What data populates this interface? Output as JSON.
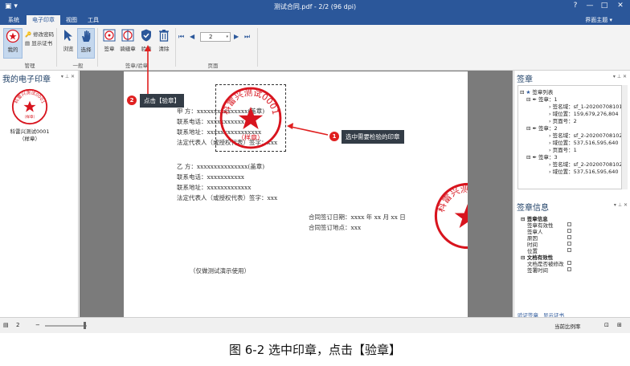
{
  "window": {
    "title": "测试合同.pdf - 2/2 (96 dpi)",
    "controls": [
      "?",
      "—",
      "□",
      "✕"
    ]
  },
  "menu": {
    "tabs": [
      "系统",
      "电子印章",
      "视图",
      "工具"
    ],
    "active": 1,
    "right": "界面主题"
  },
  "ribbon": {
    "buttons": [
      {
        "name": "my-seal-button",
        "label": "我的",
        "icon": "seal-icon"
      },
      {
        "name": "browse-button",
        "label": "浏览",
        "icon": "cursor-icon"
      },
      {
        "name": "select-button",
        "label": "选择",
        "icon": "hand-icon"
      },
      {
        "name": "sign-button",
        "label": "签章",
        "icon": "stamp-icon"
      },
      {
        "name": "cross-page-sign-button",
        "label": "骑缝章",
        "icon": "stamp-icon"
      },
      {
        "name": "verify-button",
        "label": "验章",
        "icon": "shield-icon"
      },
      {
        "name": "clear-button",
        "label": "清除",
        "icon": "trash-icon"
      }
    ],
    "small_buttons": [
      "修改密码",
      "显示证书"
    ],
    "groups": [
      "管理",
      "一般",
      "签章/验章",
      "页面"
    ],
    "page_input": "2"
  },
  "left_panel": {
    "title": "我的电子印章",
    "seal_label": "科雷兴测试0001（样章）",
    "seal_text": "科雷兴测试0001",
    "seal_subtext": "（样章）"
  },
  "document": {
    "party_a": [
      "甲      方：xxxxxxxxxxxxxxx(盖章)",
      "联系电话：xxxxxxxxxxx",
      "联系地址：xxxxxxxxxxxxxxxx",
      "法定代表人（或授权代表）签字：xxx"
    ],
    "party_b": [
      "乙      方：xxxxxxxxxxxxxxx(盖章)",
      "联系电话：xxxxxxxxxxx",
      "联系地址：xxxxxxxxxxxxx",
      "法定代表人（或授权代表）签字：xxx"
    ],
    "sign_date": "合同签订日期：xxxx 年 xx 月 xx 日",
    "sign_place": "合同签订地点：xxx",
    "watermark": "（仅做测试演示使用）",
    "stamp_text": "科雷兴测试0001",
    "stamp_sub": "（样章）"
  },
  "callouts": [
    {
      "num": "1",
      "text": "选中需要检验的印章"
    },
    {
      "num": "2",
      "text": "点击【验章】"
    }
  ],
  "right_panel": {
    "sig_title": "签章",
    "tree_root": "签章列表",
    "signatures": [
      {
        "label": "签章：1",
        "name": "签名域：sf_1-20200708101",
        "pos": "域位置：159,679,276,804",
        "page": "页面号：2"
      },
      {
        "label": "签章：2",
        "name": "签名域：sf_2-20200708102",
        "pos": "域位置：537,516,595,640",
        "page": "页面号：1"
      },
      {
        "label": "签章：3",
        "name": "签名域：sf_2-20200708102",
        "pos": "域位置：537,516,595,640"
      }
    ],
    "info_title": "签章信息",
    "info_sections": [
      {
        "head": "签章信息",
        "rows": [
          "签章有效性",
          "签章人",
          "原因",
          "时间",
          "位置"
        ]
      },
      {
        "head": "文档有效性",
        "rows": [
          "文档是否被修改",
          "签署时间"
        ]
      }
    ],
    "links": [
      "验证签章",
      "显示证书"
    ]
  },
  "status": {
    "page": "2",
    "right": "当前比例率"
  },
  "caption": "图  6-2 选中印章，点击【验章】",
  "colors": {
    "accent": "#2b579a",
    "seal_red": "#d8141e"
  }
}
